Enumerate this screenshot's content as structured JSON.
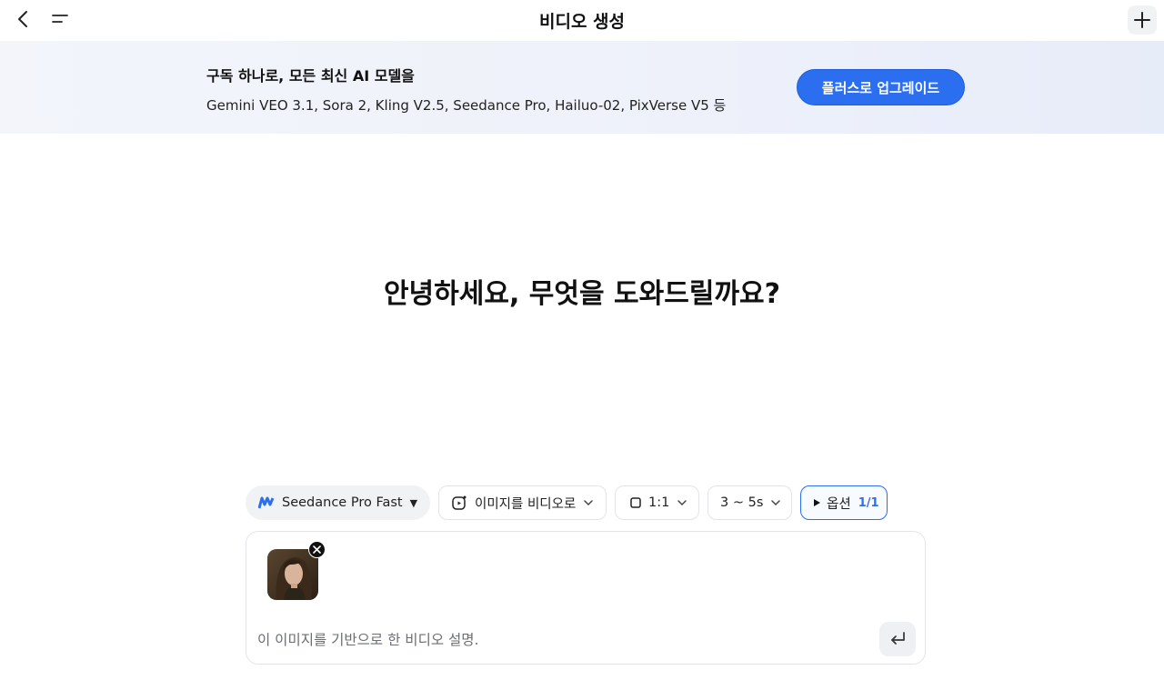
{
  "header": {
    "title": "비디오 생성",
    "back_icon": "chevron-left-icon",
    "menu_icon": "menu-icon",
    "new_icon": "plus-icon"
  },
  "banner": {
    "headline": "구독 하나로, 모든 최신 AI 모델을",
    "models": "Gemini VEO 3.1, Sora 2, Kling V2.5, Seedance Pro, Hailuo-02, PixVerse V5 등",
    "upgrade_label": "플러스로 업그레이드",
    "accent": "#2b6ff0"
  },
  "main": {
    "greeting": "안녕하세요, 무엇을 도와드릴까요?"
  },
  "toolbar": {
    "model": {
      "label": "Seedance Pro Fast",
      "icon": "seedance-logo-icon"
    },
    "mode": {
      "label": "이미지를 비디오로",
      "icon": "image-video-icon"
    },
    "ratio": {
      "label": "1:1",
      "icon": "square-icon"
    },
    "duration": {
      "label": "3 ~ 5s"
    },
    "options": {
      "label": "옵션",
      "count": "1/1",
      "icon": "play-icon"
    }
  },
  "composer": {
    "attachment": {
      "type": "portrait image",
      "remove_icon": "close-icon"
    },
    "placeholder": "이 이미지를 기반으로 한 비디오 설명.",
    "value": "",
    "send_icon": "enter-icon"
  }
}
